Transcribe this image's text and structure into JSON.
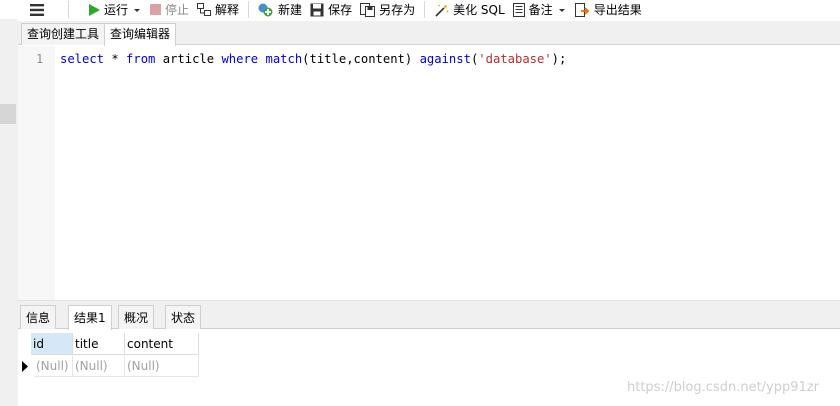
{
  "toolbar": {
    "run_label": "运行",
    "stop_label": "停止",
    "explain_label": "解释",
    "new_label": "新建",
    "save_label": "保存",
    "save_as_label": "另存为",
    "beautify_label": "美化 SQL",
    "comment_label": "备注",
    "export_label": "导出结果"
  },
  "editor_tabs": [
    {
      "label": "查询创建工具"
    },
    {
      "label": "查询编辑器"
    }
  ],
  "editor": {
    "line_number": "1",
    "tokens": [
      {
        "text": "select",
        "color": "#0000cc"
      },
      {
        "text": " * ",
        "color": "#000000"
      },
      {
        "text": "from",
        "color": "#0000cc"
      },
      {
        "text": " article ",
        "color": "#000000"
      },
      {
        "text": "where",
        "color": "#0000cc"
      },
      {
        "text": " ",
        "color": "#000000"
      },
      {
        "text": "match",
        "color": "#0000cc"
      },
      {
        "text": "(title,content) ",
        "color": "#000000"
      },
      {
        "text": "against",
        "color": "#0000cc"
      },
      {
        "text": "(",
        "color": "#000000"
      },
      {
        "text": "'database'",
        "color": "#b03030"
      },
      {
        "text": ");",
        "color": "#000000"
      }
    ]
  },
  "result_tabs": [
    {
      "label": "信息"
    },
    {
      "label": "结果1"
    },
    {
      "label": "概况"
    },
    {
      "label": "状态"
    }
  ],
  "grid": {
    "columns": [
      "id",
      "title",
      "content"
    ],
    "rows": [
      [
        "(Null)",
        "(Null)",
        "(Null)"
      ]
    ]
  },
  "watermark": "https://blog.csdn.net/ypp91zr",
  "colors": {
    "keyword": "#0000cc",
    "string": "#b03030",
    "run_green": "#2da82d",
    "selected_header": "#d6e8f8"
  }
}
